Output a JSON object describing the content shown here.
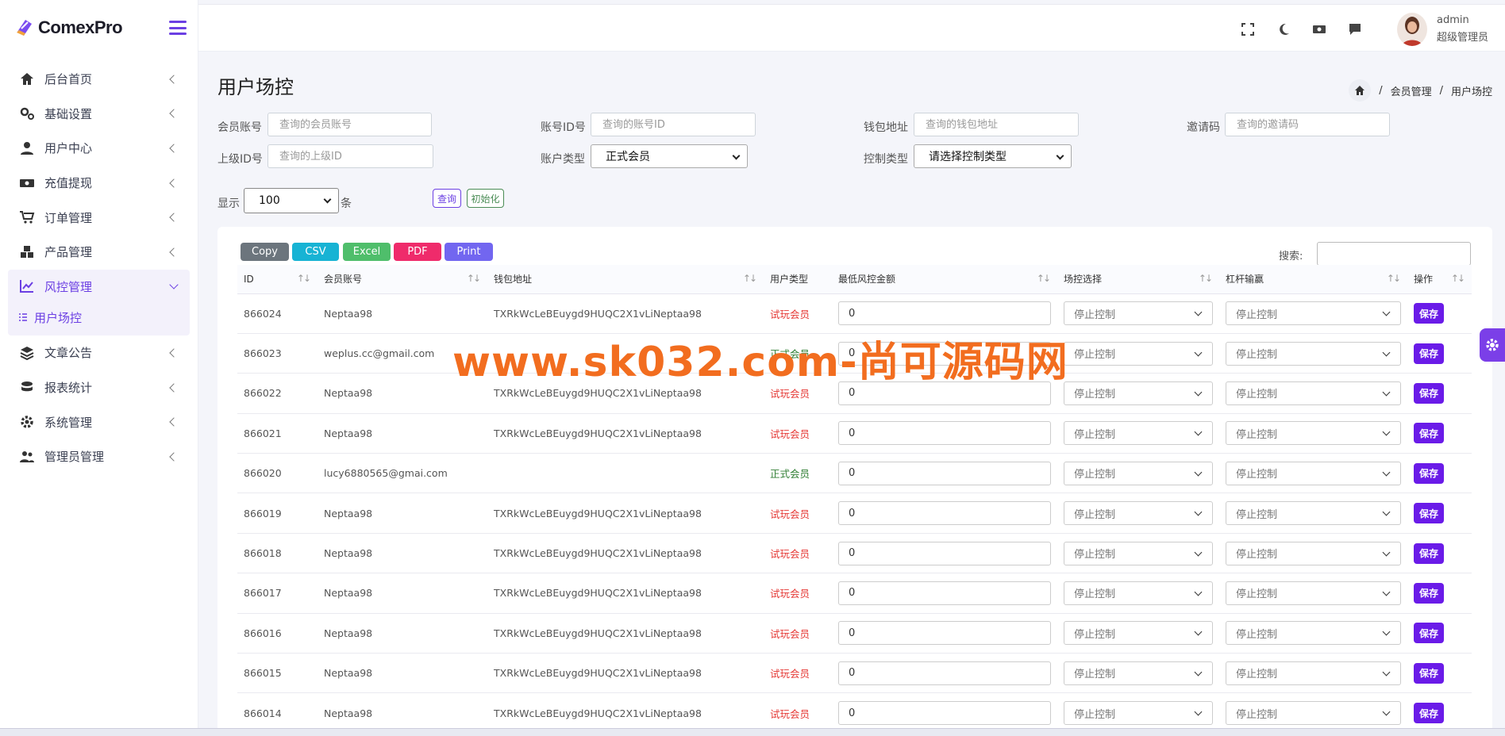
{
  "brand": {
    "name": "ComexPro"
  },
  "header": {
    "user_name": "admin",
    "user_role": "超级管理员"
  },
  "sidebar": {
    "items": [
      {
        "label": "后台首页",
        "icon": "home-icon"
      },
      {
        "label": "基础设置",
        "icon": "gears-icon"
      },
      {
        "label": "用户中心",
        "icon": "user-icon"
      },
      {
        "label": "充值提现",
        "icon": "money-icon"
      },
      {
        "label": "订单管理",
        "icon": "cart-icon"
      },
      {
        "label": "产品管理",
        "icon": "cubes-icon"
      },
      {
        "label": "风控管理",
        "icon": "chart-line-icon",
        "active": true
      },
      {
        "label": "文章公告",
        "icon": "layers-icon"
      },
      {
        "label": "报表统计",
        "icon": "coins-icon"
      },
      {
        "label": "系统管理",
        "icon": "gear-icon"
      },
      {
        "label": "管理员管理",
        "icon": "users-icon"
      }
    ],
    "sub_item": "用户场控"
  },
  "page": {
    "title": "用户场控",
    "breadcrumb": [
      "会员管理",
      "用户场控"
    ],
    "separator": "/"
  },
  "filters": {
    "member_account": {
      "label": "会员账号",
      "placeholder": "查询的会员账号"
    },
    "account_id": {
      "label": "账号ID号",
      "placeholder": "查询的账号ID"
    },
    "wallet": {
      "label": "钱包地址",
      "placeholder": "查询的钱包地址"
    },
    "invite": {
      "label": "邀请码",
      "placeholder": "查询的邀请码"
    },
    "parent_id": {
      "label": "上级ID号",
      "placeholder": "查询的上级ID"
    },
    "account_type": {
      "label": "账户类型",
      "value": "正式会员"
    },
    "control_type": {
      "label": "控制类型",
      "value": "请选择控制类型"
    },
    "show_label": "显示",
    "show_value": "100",
    "show_unit": "条",
    "query_btn": "查询",
    "reset_btn": "初始化"
  },
  "export": {
    "buttons": [
      {
        "label": "Copy",
        "color": "#6c757d"
      },
      {
        "label": "CSV",
        "color": "#17b3d4"
      },
      {
        "label": "Excel",
        "color": "#4fbe6b"
      },
      {
        "label": "PDF",
        "color": "#ef2b6b"
      },
      {
        "label": "Print",
        "color": "#7266f0"
      }
    ],
    "search_label": "搜索:"
  },
  "table": {
    "columns": [
      "ID",
      "会员账号",
      "钱包地址",
      "用户类型",
      "最低风控金额",
      "场控选择",
      "杠杆输赢",
      "操作"
    ],
    "rows": [
      {
        "id": "866024",
        "account": "Neptaa98",
        "wallet": "TXRkWcLeBEuygd9HUQC2X1vLiNeptaa98",
        "type": "试玩会员",
        "amount": "0",
        "control": "停止控制",
        "leverage": "停止控制",
        "action": "保存"
      },
      {
        "id": "866023",
        "account": "weplus.cc@gmail.com",
        "wallet": "",
        "type": "正式会员",
        "amount": "0",
        "control": "停止控制",
        "leverage": "停止控制",
        "action": "保存"
      },
      {
        "id": "866022",
        "account": "Neptaa98",
        "wallet": "TXRkWcLeBEuygd9HUQC2X1vLiNeptaa98",
        "type": "试玩会员",
        "amount": "0",
        "control": "停止控制",
        "leverage": "停止控制",
        "action": "保存"
      },
      {
        "id": "866021",
        "account": "Neptaa98",
        "wallet": "TXRkWcLeBEuygd9HUQC2X1vLiNeptaa98",
        "type": "试玩会员",
        "amount": "0",
        "control": "停止控制",
        "leverage": "停止控制",
        "action": "保存"
      },
      {
        "id": "866020",
        "account": "lucy6880565@gmai.com",
        "wallet": "",
        "type": "正式会员",
        "amount": "0",
        "control": "停止控制",
        "leverage": "停止控制",
        "action": "保存"
      },
      {
        "id": "866019",
        "account": "Neptaa98",
        "wallet": "TXRkWcLeBEuygd9HUQC2X1vLiNeptaa98",
        "type": "试玩会员",
        "amount": "0",
        "control": "停止控制",
        "leverage": "停止控制",
        "action": "保存"
      },
      {
        "id": "866018",
        "account": "Neptaa98",
        "wallet": "TXRkWcLeBEuygd9HUQC2X1vLiNeptaa98",
        "type": "试玩会员",
        "amount": "0",
        "control": "停止控制",
        "leverage": "停止控制",
        "action": "保存"
      },
      {
        "id": "866017",
        "account": "Neptaa98",
        "wallet": "TXRkWcLeBEuygd9HUQC2X1vLiNeptaa98",
        "type": "试玩会员",
        "amount": "0",
        "control": "停止控制",
        "leverage": "停止控制",
        "action": "保存"
      },
      {
        "id": "866016",
        "account": "Neptaa98",
        "wallet": "TXRkWcLeBEuygd9HUQC2X1vLiNeptaa98",
        "type": "试玩会员",
        "amount": "0",
        "control": "停止控制",
        "leverage": "停止控制",
        "action": "保存"
      },
      {
        "id": "866015",
        "account": "Neptaa98",
        "wallet": "TXRkWcLeBEuygd9HUQC2X1vLiNeptaa98",
        "type": "试玩会员",
        "amount": "0",
        "control": "停止控制",
        "leverage": "停止控制",
        "action": "保存"
      },
      {
        "id": "866014",
        "account": "Neptaa98",
        "wallet": "TXRkWcLeBEuygd9HUQC2X1vLiNeptaa98",
        "type": "试玩会员",
        "amount": "0",
        "control": "停止控制",
        "leverage": "停止控制",
        "action": "保存"
      }
    ]
  },
  "watermark": "www.sk032.com-尚可源码网",
  "colors": {
    "accent": "#6b3fe3",
    "save": "#6a1be8",
    "trial": "#e53935",
    "formal": "#2e7d32",
    "watermark": "#f26d1f"
  }
}
